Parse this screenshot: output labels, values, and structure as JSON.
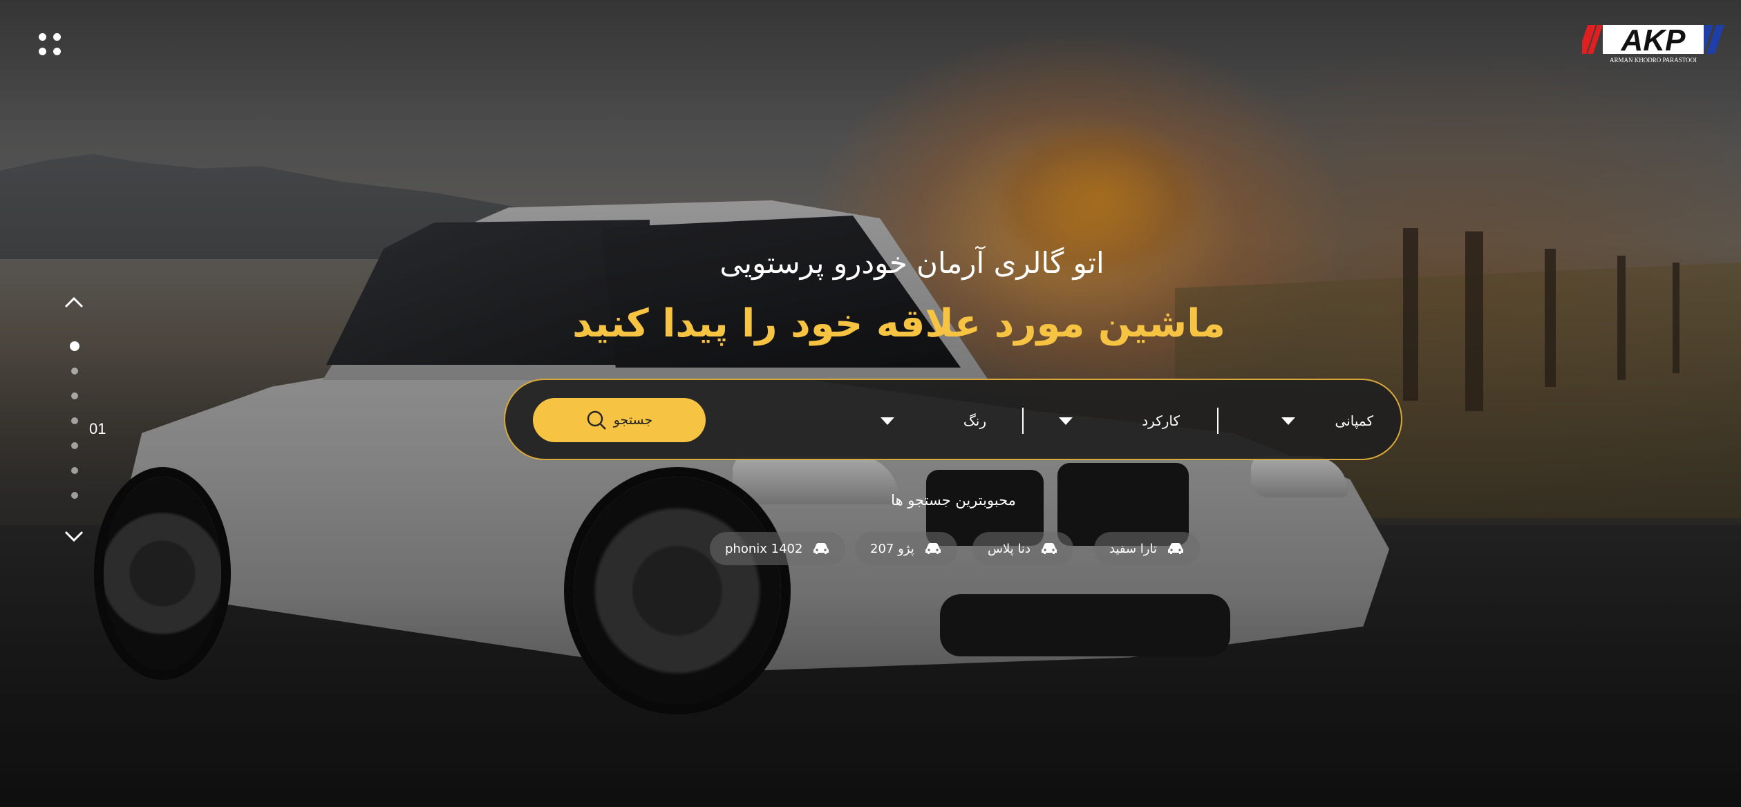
{
  "brand": {
    "logo_text": "AKP",
    "logo_subtitle": "ARMAN KHODRO PARASTOOI"
  },
  "header": {
    "menu_icon": "grid-dots-icon"
  },
  "slider": {
    "current_slide": "01",
    "dot_count": 7,
    "active_index": 0,
    "up_icon": "chevron-up-icon",
    "down_icon": "chevron-down-icon"
  },
  "hero": {
    "subtitle": "اتو گالری آرمان خودرو پرستویی",
    "title": "ماشین مورد علاقه خود را پیدا کنید"
  },
  "search": {
    "company_label": "کمپانی",
    "mileage_label": "کارکرد",
    "color_label": "رنگ",
    "button_label": "جستجو",
    "button_icon": "search-icon"
  },
  "popular": {
    "label": "محبوبترین جستجو ها",
    "items": [
      {
        "label": "تارا سفید",
        "icon": "car-icon"
      },
      {
        "label": "دنا پلاس",
        "icon": "car-icon"
      },
      {
        "label": "پژو 207",
        "icon": "car-icon"
      },
      {
        "label": "phonix 1402",
        "icon": "car-icon"
      }
    ]
  },
  "colors": {
    "accent": "#f6c343",
    "bar_border": "#d9a93a",
    "logo_red": "#e02020",
    "logo_blue": "#1e3ea8"
  }
}
